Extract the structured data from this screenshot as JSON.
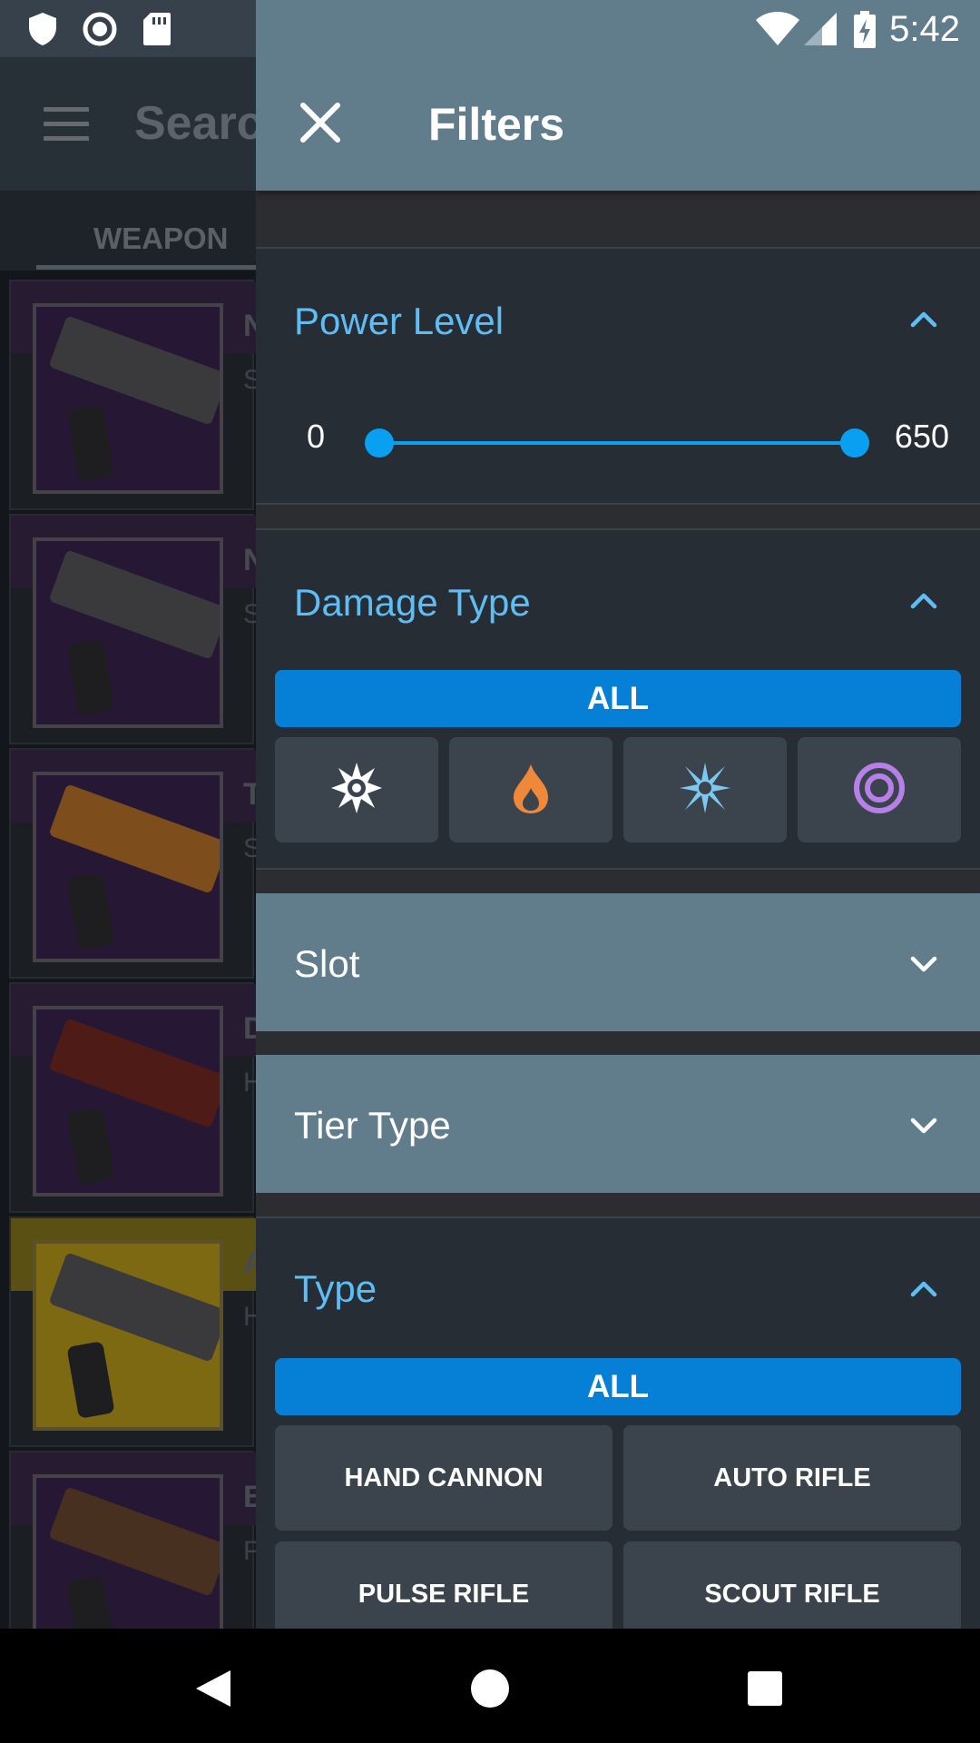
{
  "status_bar": {
    "time": "5:42",
    "icons": [
      "shield-icon",
      "record-icon",
      "sd-card-icon",
      "wifi-icon",
      "signal-icon",
      "battery-charging-icon"
    ]
  },
  "background_app": {
    "search_placeholder": "Searc",
    "tab_label": "WEAPON",
    "rows": [
      {
        "initial": "N",
        "sub": "S",
        "highlight": "purple"
      },
      {
        "initial": "N",
        "sub": "S",
        "highlight": "purple"
      },
      {
        "initial": "T",
        "sub": "S",
        "highlight": "purple"
      },
      {
        "initial": "D",
        "sub": "H",
        "highlight": "purple"
      },
      {
        "initial": "A",
        "sub": "H",
        "highlight": "gold"
      },
      {
        "initial": "B",
        "sub": "P",
        "highlight": "purple"
      }
    ]
  },
  "drawer": {
    "title": "Filters",
    "close_icon": "close-icon",
    "power_level": {
      "title": "Power Level",
      "min": "0",
      "max": "650",
      "range": [
        0,
        650
      ],
      "selected": [
        0,
        650
      ]
    },
    "damage_type": {
      "title": "Damage Type",
      "all_label": "ALL",
      "options": [
        {
          "icon": "kinetic-icon",
          "color": "#ffffff"
        },
        {
          "icon": "solar-icon",
          "color": "#f0883a"
        },
        {
          "icon": "arc-icon",
          "color": "#7cc8f0"
        },
        {
          "icon": "void-icon",
          "color": "#b77fe8"
        }
      ]
    },
    "slot": {
      "title": "Slot"
    },
    "tier_type": {
      "title": "Tier Type"
    },
    "type": {
      "title": "Type",
      "all_label": "ALL",
      "options": [
        "HAND CANNON",
        "AUTO RIFLE",
        "PULSE RIFLE",
        "SCOUT RIFLE"
      ]
    }
  },
  "colors": {
    "accent": "#5ebdf4",
    "primary_button": "#0680d6",
    "appbar": "#617d8c"
  }
}
